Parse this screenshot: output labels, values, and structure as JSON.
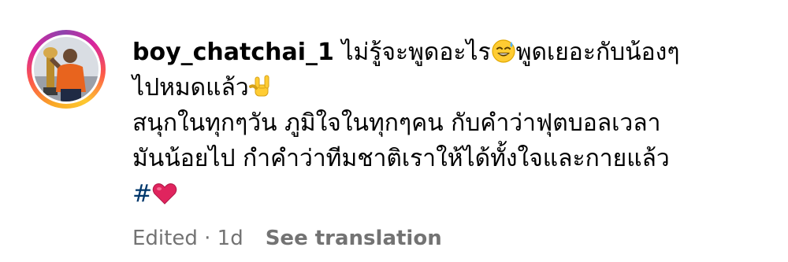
{
  "comment": {
    "username": "boy_chatchai_1",
    "lines": [
      {
        "before": " ไม่รู้จะพูดอะไร",
        "emoji": "sweat-smile-emoji",
        "after": "พูดเยอะกับน้องๆ"
      },
      {
        "before": "ไปหมดแล้ว",
        "emoji": "rock-hand-emoji",
        "after": ""
      },
      {
        "text": "สนุกในทุกๆวัน ภูมิใจในทุกๆคน กับคำว่าฟุตบอลเวลา"
      },
      {
        "text": "มันน้อยไป กำคำว่าทีมชาติเราให้ได้ทั้งใจและกายแล้ว"
      },
      {
        "hashtag": "#",
        "emoji": "red-heart-emoji"
      }
    ]
  },
  "meta": {
    "edited": "Edited",
    "separator": " · ",
    "age": "1d",
    "see_translation": "See translation"
  },
  "colors": {
    "text": "#000000",
    "muted": "#737373",
    "hashtag": "#00376b",
    "heart": "#e0245e"
  }
}
